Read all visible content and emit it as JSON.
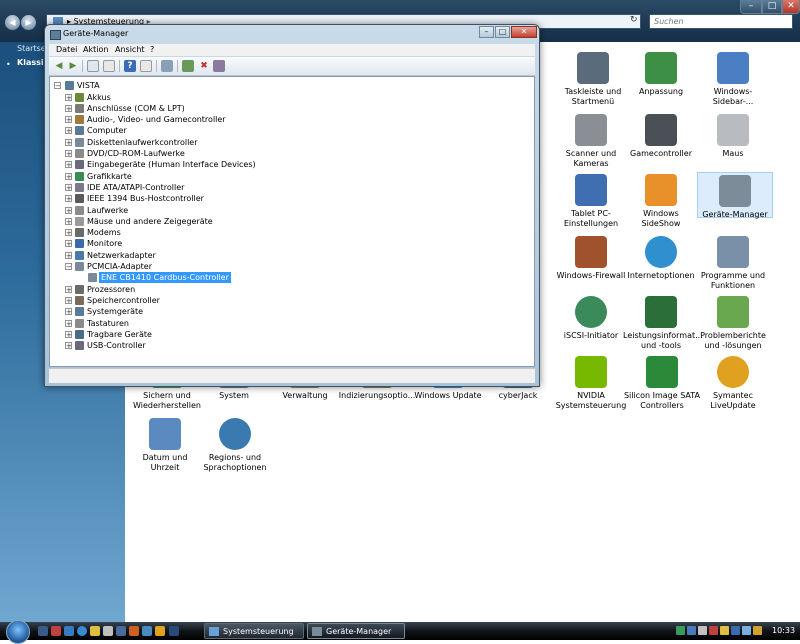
{
  "explorer": {
    "address_path": "Systemsteuerung",
    "address_sep": "▸",
    "search_placeholder": "Suchen",
    "sidebar": {
      "link_home": "Startseite",
      "link_classic": "Klassische Ansicht"
    },
    "items": [
      {
        "label": "Taskleiste und Startmenü",
        "icon": "taskbar-icon",
        "color": "#5a6b7c"
      },
      {
        "label": "Anpassung",
        "icon": "personalization-icon",
        "color": "#3d8f46"
      },
      {
        "label": "Windows-Sidebar-...",
        "icon": "sidebar-icon",
        "color": "#4a7fc4"
      },
      {
        "label": "Scanner und Kameras",
        "icon": "scanner-icon",
        "color": "#8a8f95"
      },
      {
        "label": "Gamecontroller",
        "icon": "gamepad-icon",
        "color": "#4a5055"
      },
      {
        "label": "Maus",
        "icon": "mouse-icon",
        "color": "#b8bcc0"
      },
      {
        "label": "Tablet PC-Einstellungen",
        "icon": "tablet-icon",
        "color": "#3f6fb0"
      },
      {
        "label": "Windows SideShow",
        "icon": "sideshow-icon",
        "color": "#e8902a"
      },
      {
        "label": "Geräte-Manager",
        "icon": "device-manager-icon",
        "color": "#7c8c98"
      },
      {
        "label": "Windows-Firewall",
        "icon": "firewall-icon",
        "color": "#a0522d"
      },
      {
        "label": "Internetoptionen",
        "icon": "globe-icon",
        "color": "#2f8fcf"
      },
      {
        "label": "Programme und Funktionen",
        "icon": "programs-icon",
        "color": "#7a8fa8"
      },
      {
        "label": "iSCSI-Initiator",
        "icon": "iscsi-icon",
        "color": "#3a8a5a"
      },
      {
        "label": "Leistungsinformat... und -tools",
        "icon": "performance-icon",
        "color": "#2c6e3a"
      },
      {
        "label": "Problemberichte und -lösungen",
        "icon": "problem-reports-icon",
        "color": "#6aa84f"
      },
      {
        "label": "Sichern und Wiederherstellen",
        "icon": "backup-icon",
        "color": "#4a9a4a"
      },
      {
        "label": "System",
        "icon": "system-icon",
        "color": "#6a7a8a"
      },
      {
        "label": "Verwaltung",
        "icon": "admin-tools-icon",
        "color": "#8a8a6a"
      },
      {
        "label": "Indizierungsoptio...",
        "icon": "indexing-icon",
        "color": "#9a7a4a"
      },
      {
        "label": "Windows Update",
        "icon": "windows-update-icon",
        "color": "#3a8ad0"
      },
      {
        "label": "cyberJack",
        "icon": "cyberjack-icon",
        "color": "#4a6a8a"
      },
      {
        "label": "NVIDIA Systemsteuerung",
        "icon": "nvidia-icon",
        "color": "#76b900"
      },
      {
        "label": "Silicon Image SATA Controllers",
        "icon": "sata-icon",
        "color": "#2a8a3a"
      },
      {
        "label": "Symantec LiveUpdate",
        "icon": "symantec-icon",
        "color": "#e0a020"
      },
      {
        "label": "Datum und Uhrzeit",
        "icon": "clock-icon",
        "color": "#5a8ac0"
      },
      {
        "label": "Regions- und Sprachoptionen",
        "icon": "region-icon",
        "color": "#3a7ab0"
      }
    ]
  },
  "device_manager": {
    "title": "Geräte-Manager",
    "menu": [
      "Datei",
      "Aktion",
      "Ansicht",
      "?"
    ],
    "min_glyph": "–",
    "max_glyph": "□",
    "close_glyph": "✕",
    "tree_root": "VISTA",
    "tree": [
      {
        "label": "Akkus",
        "color": "#6a8a3a"
      },
      {
        "label": "Anschlüsse (COM & LPT)",
        "color": "#7a7a7a"
      },
      {
        "label": "Audio-, Video- und Gamecontroller",
        "color": "#a07a3a"
      },
      {
        "label": "Computer",
        "color": "#5a7a9a"
      },
      {
        "label": "Diskettenlaufwerkcontroller",
        "color": "#7a8a9a"
      },
      {
        "label": "DVD/CD-ROM-Laufwerke",
        "color": "#8a8a8a"
      },
      {
        "label": "Eingabegeräte (Human Interface Devices)",
        "color": "#6a6a7a"
      },
      {
        "label": "Grafikkarte",
        "color": "#3a8a5a"
      },
      {
        "label": "IDE ATA/ATAPI-Controller",
        "color": "#7a7a8a"
      },
      {
        "label": "IEEE 1394 Bus-Hostcontroller",
        "color": "#5a5a5a"
      },
      {
        "label": "Laufwerke",
        "color": "#8a8a8a"
      },
      {
        "label": "Mäuse und andere Zeigegeräte",
        "color": "#9a9a9a"
      },
      {
        "label": "Modems",
        "color": "#6a6a6a"
      },
      {
        "label": "Monitore",
        "color": "#3a6aaa"
      },
      {
        "label": "Netzwerkadapter",
        "color": "#4a7aaa"
      },
      {
        "label": "PCMCIA-Adapter",
        "color": "#7a8a9a",
        "expanded": true
      },
      {
        "label": "ENE CB1410 Cardbus-Controller",
        "color": "#7a8a9a",
        "child": true,
        "selected": true
      },
      {
        "label": "Prozessoren",
        "color": "#6a6a6a"
      },
      {
        "label": "Speichercontroller",
        "color": "#7a6a5a"
      },
      {
        "label": "Systemgeräte",
        "color": "#5a7a9a"
      },
      {
        "label": "Tastaturen",
        "color": "#8a8a8a"
      },
      {
        "label": "Tragbare Geräte",
        "color": "#4a6a8a"
      },
      {
        "label": "USB-Controller",
        "color": "#6a6a7a"
      }
    ]
  },
  "taskbar": {
    "tasks": [
      "Systemsteuerung",
      "Geräte-Manager"
    ],
    "clock": "10:33"
  }
}
